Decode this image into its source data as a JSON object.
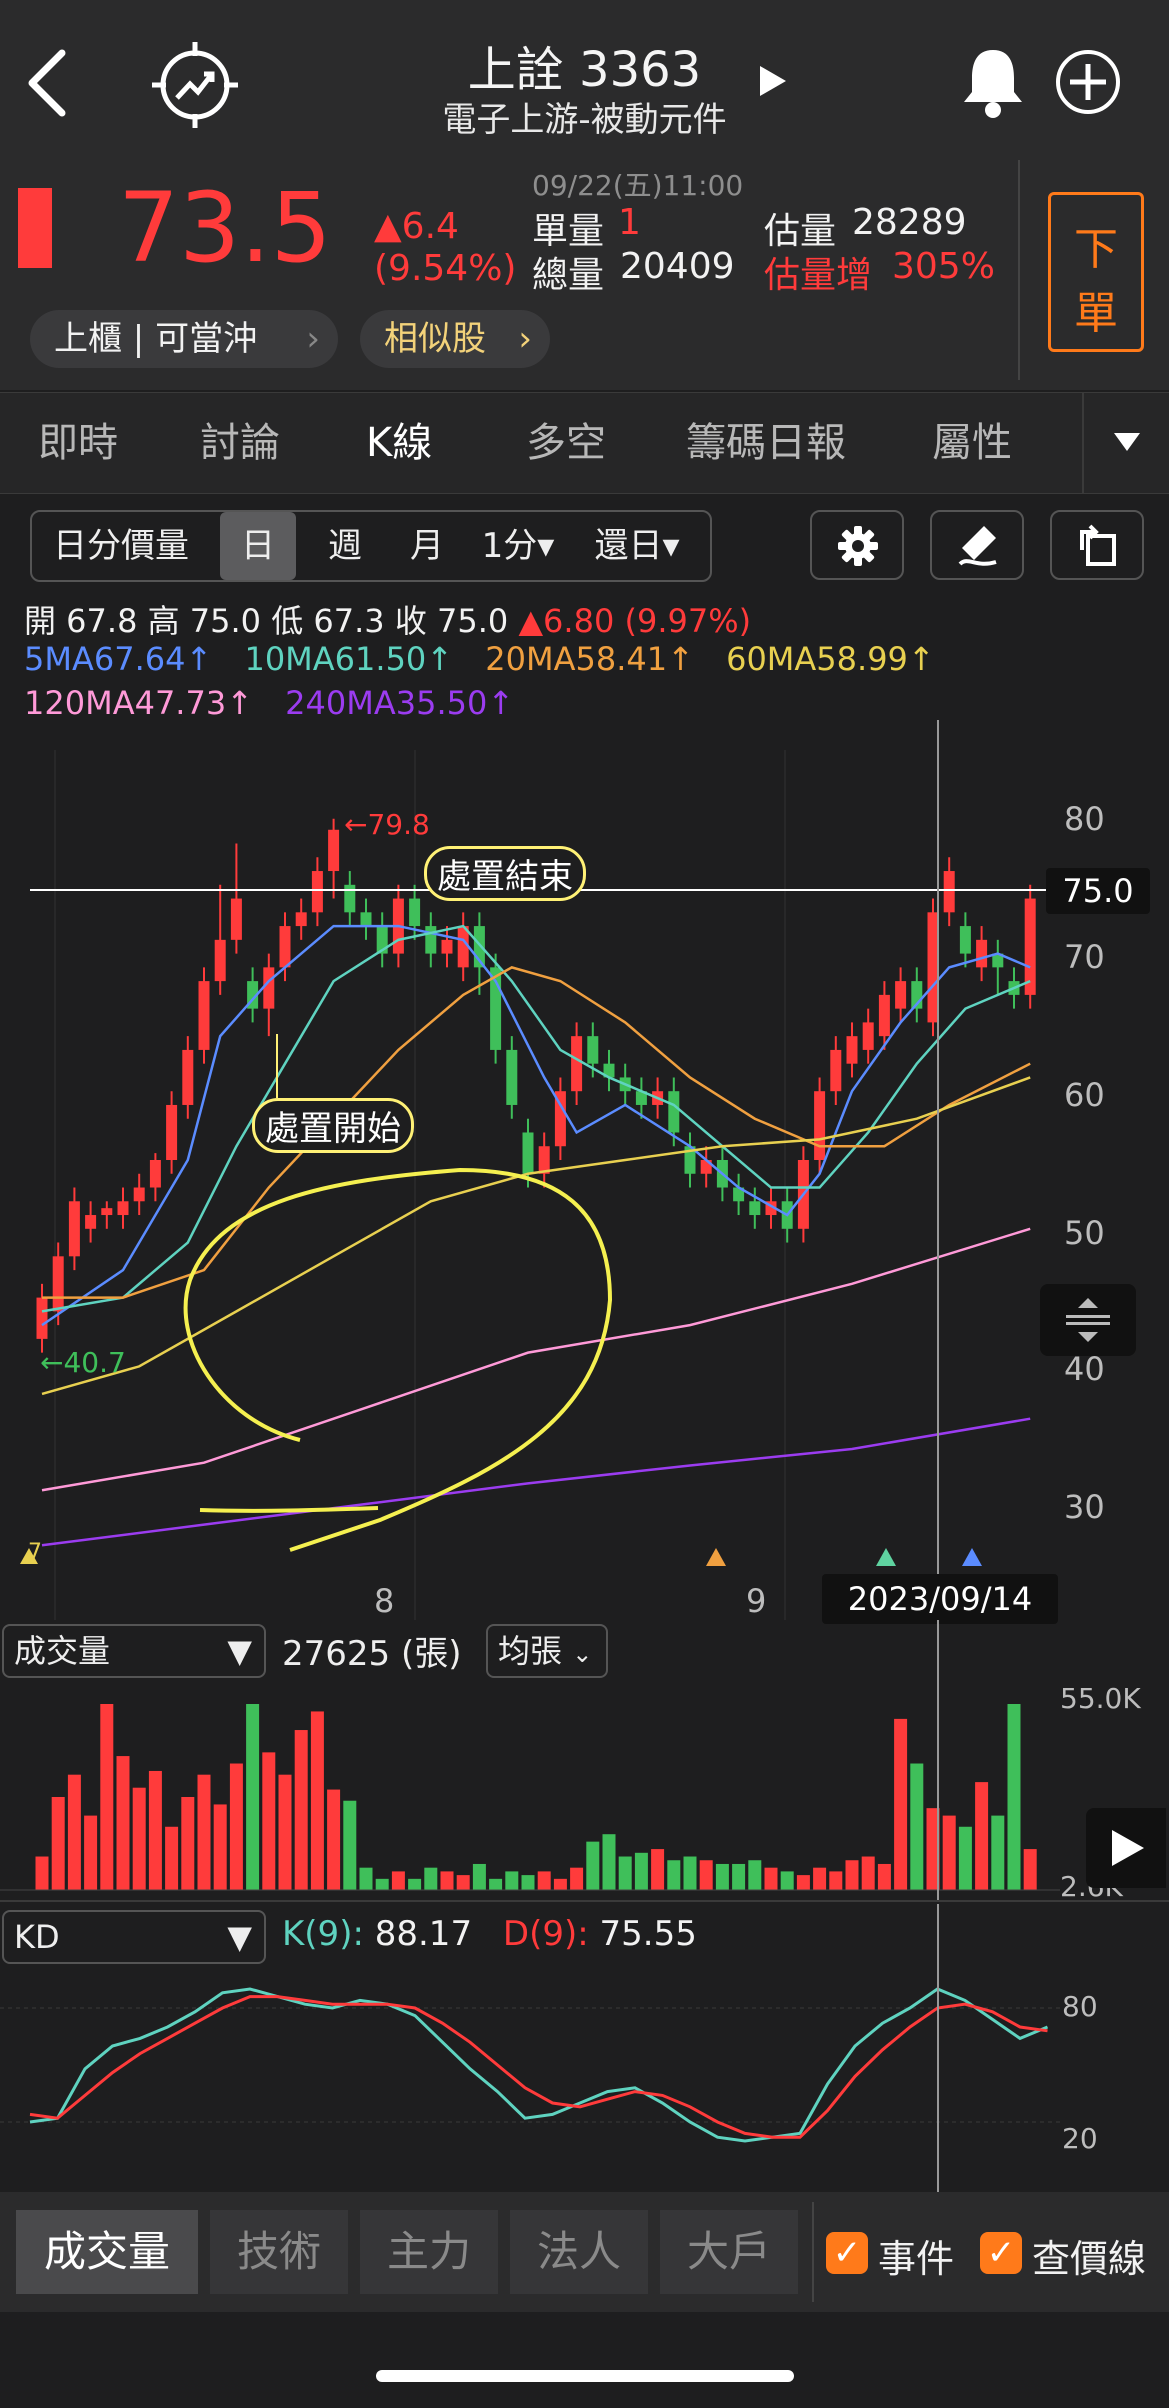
{
  "header": {
    "title": "上詮 3363",
    "subtitle": "電子上游-被動元件"
  },
  "quote": {
    "timestamp": "09/22(五)11:00",
    "price": "73.5",
    "change": "▲6.4",
    "change_pct": "(9.54%)",
    "single_vol_label": "單量",
    "single_vol": "1",
    "total_vol_label": "總量",
    "total_vol": "20409",
    "est_vol_label": "估量",
    "est_vol": "28289",
    "est_inc_label": "估量增",
    "est_inc": "305%",
    "order_btn": [
      "下",
      "單"
    ],
    "market_tag": "上櫃 | 可當沖",
    "similar_btn": "相似股"
  },
  "tabs": [
    "即時",
    "討論",
    "K線",
    "多空",
    "籌碼日報",
    "屬性"
  ],
  "active_tab": "K線",
  "period_bar": {
    "items": [
      "日分價量",
      "日",
      "週",
      "月",
      "1分▾",
      "還日▾"
    ],
    "active": "日"
  },
  "ohlc": {
    "open": "開 67.8",
    "high": "高 75.0",
    "low": "低 67.3",
    "close": "收 75.0",
    "change": "▲6.80 (9.97%)"
  },
  "ma": [
    {
      "text": "5MA67.64↑",
      "color": "#5b8cff"
    },
    {
      "text": "10MA61.50↑",
      "color": "#5fd3c0"
    },
    {
      "text": "20MA58.41↑",
      "color": "#f0a040"
    },
    {
      "text": "60MA58.99↑",
      "color": "#e8d050"
    },
    {
      "text": "120MA47.73↑",
      "color": "#ff9ad8"
    },
    {
      "text": "240MA35.50↑",
      "color": "#9b3cf0"
    }
  ],
  "price_chart": {
    "y_ticks": [
      "80",
      "70",
      "60",
      "50",
      "40",
      "30"
    ],
    "current_price_tag": "75.0",
    "high_marker": "←79.8",
    "low_marker": "←40.7",
    "annotation_start": "處置開始",
    "annotation_end": "處置結束",
    "x_labels": [
      "8",
      "9"
    ],
    "crosshair_date": "2023/09/14",
    "left_marker": "7"
  },
  "volume_panel": {
    "dropdown": "成交量",
    "value": "27625 (張)",
    "unit_dropdown": "均張",
    "y_top": "55.0K",
    "y_bottom": "2.6K"
  },
  "kd_panel": {
    "dropdown": "KD",
    "k_label": "K(9):",
    "k_value": "88.17",
    "d_label": "D(9):",
    "d_value": "75.55",
    "y_ticks": [
      "80",
      "20"
    ]
  },
  "bottom_tabs": [
    "成交量",
    "技術",
    "主力",
    "法人",
    "大戶"
  ],
  "active_bottom_tab": "成交量",
  "checkboxes": [
    {
      "label": "事件",
      "checked": true
    },
    {
      "label": "查價線",
      "checked": true
    }
  ],
  "colors": {
    "up": "#ff3b3b",
    "down": "#3fbf5a",
    "accent": "#ff7a1a",
    "highlight": "#fff176"
  }
}
